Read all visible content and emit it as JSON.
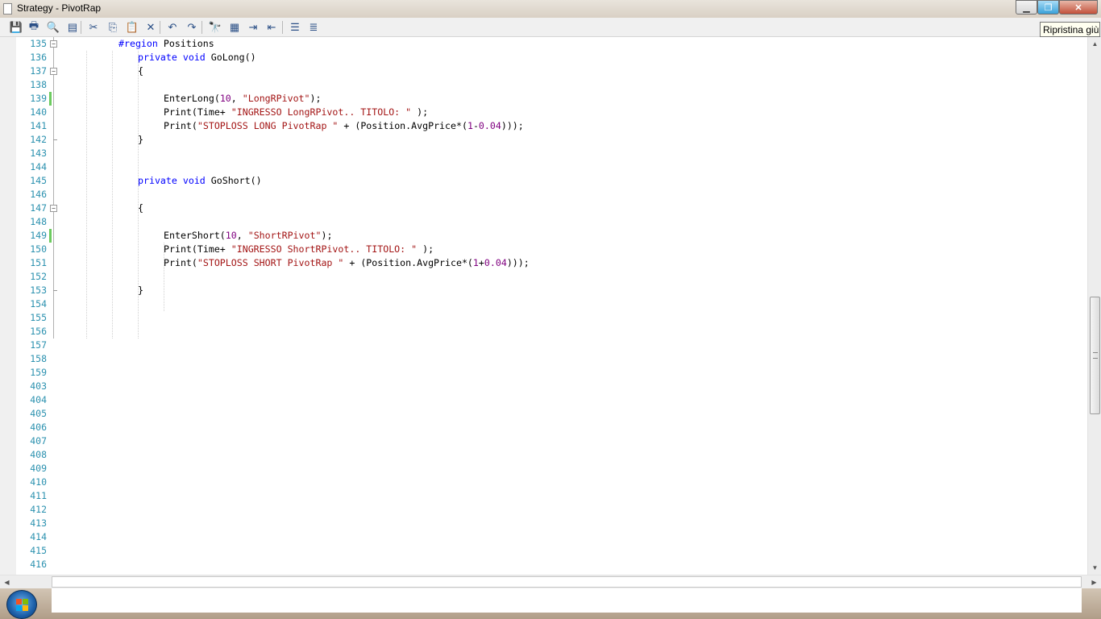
{
  "window": {
    "title": "Strategy - PivotRap"
  },
  "tooltip": {
    "text": "Ripristina giù"
  },
  "toolbar": {
    "buttons": [
      {
        "name": "save-icon",
        "glyph": "💾"
      },
      {
        "name": "print-icon",
        "glyph": "🖶"
      },
      {
        "name": "print-preview-icon",
        "glyph": "🔍"
      },
      {
        "name": "page-setup-icon",
        "glyph": "▤"
      },
      {
        "name": "cut-icon",
        "glyph": "✂"
      },
      {
        "name": "copy-icon",
        "glyph": "⎘"
      },
      {
        "name": "paste-icon",
        "glyph": "📋"
      },
      {
        "name": "delete-icon",
        "glyph": "✕"
      },
      {
        "name": "undo-icon",
        "glyph": "↶"
      },
      {
        "name": "redo-icon",
        "glyph": "↷"
      },
      {
        "name": "find-icon",
        "glyph": "🔭"
      },
      {
        "name": "replace-icon",
        "glyph": "▦"
      },
      {
        "name": "indent-icon",
        "glyph": "⇥"
      },
      {
        "name": "outdent-icon",
        "glyph": "⇤"
      },
      {
        "name": "comment-icon",
        "glyph": "☰"
      },
      {
        "name": "uncomment-icon",
        "glyph": "≣"
      }
    ]
  },
  "editor": {
    "line_numbers": [
      "135",
      "136",
      "137",
      "138",
      "139",
      "140",
      "141",
      "142",
      "143",
      "144",
      "145",
      "146",
      "147",
      "148",
      "149",
      "150",
      "151",
      "152",
      "153",
      "154",
      "155",
      "156",
      "157",
      "158",
      "159",
      "403",
      "404",
      "405",
      "406",
      "407",
      "408",
      "409",
      "410",
      "411",
      "412",
      "413",
      "414",
      "415",
      "416"
    ],
    "lines": {
      "l135": {
        "pp": "#region",
        "rest": " Positions"
      },
      "l136": {
        "kw1": "private",
        "kw2": "void",
        "rest": " GoLong()"
      },
      "l137": {
        "text": "{"
      },
      "l139": {
        "a": "EnterLong(",
        "n": "10",
        "b": ", ",
        "s": "\"LongRPivot\"",
        "c": ");"
      },
      "l140": {
        "a": "Print(Time+ ",
        "s": "\"INGRESSO LongRPivot.. TITOLO: \"",
        "c": " );"
      },
      "l141": {
        "a": "Print(",
        "s": "\"STOPLOSS LONG PivotRap \"",
        "b": " + (Position.AvgPrice*(",
        "n1": "1",
        "op": "-",
        "n2": "0.04",
        "c": ")));"
      },
      "l142": {
        "text": "}"
      },
      "l145": {
        "kw1": "private",
        "kw2": "void",
        "rest": " GoShort()"
      },
      "l147": {
        "text": "{"
      },
      "l149": {
        "a": "EnterShort(",
        "n": "10",
        "b": ", ",
        "s": "\"ShortRPivot\"",
        "c": ");"
      },
      "l150": {
        "a": "Print(Time+ ",
        "s": "\"INGRESSO ShortRPivot.. TITOLO: \"",
        "c": " );"
      },
      "l151": {
        "a": "Print(",
        "s": "\"STOPLOSS SHORT PivotRap \"",
        "b": " + (Position.AvgPrice*(",
        "n1": "1",
        "op": "+",
        "n2": "0.04",
        "c": ")));"
      },
      "l153": {
        "text": "}"
      }
    }
  },
  "colors": {
    "line_number": "#2b91af",
    "keyword": "#0000ff",
    "string": "#a31515",
    "number": "#800080",
    "changed_marker": "#6ccb5f"
  }
}
